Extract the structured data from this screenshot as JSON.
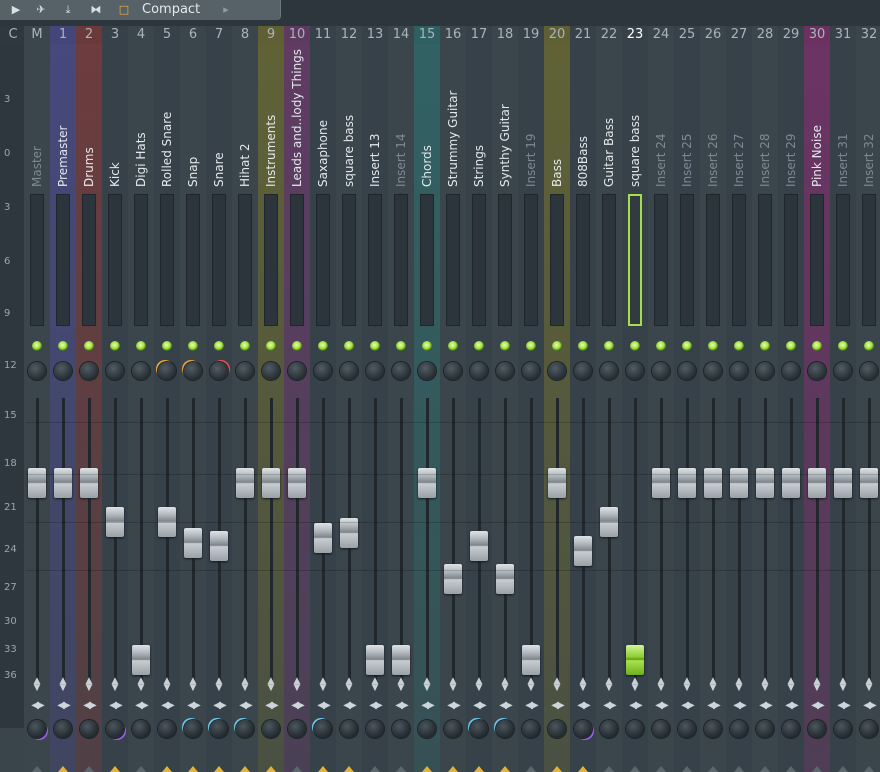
{
  "toolbar": {
    "view_label": "Compact",
    "icons": [
      "play-arrow-icon",
      "mixer-icon",
      "download-icon",
      "routing-icon",
      "view-square-icon",
      "chevron-right-icon"
    ]
  },
  "header": {
    "c_label": "C",
    "m_label": "M"
  },
  "scale": [
    "3",
    "0",
    "3",
    "6",
    "9",
    "12",
    "15",
    "18",
    "21",
    "24",
    "27",
    "30",
    "33",
    "36"
  ],
  "colors": {
    "selected_accent": "#a6dd4a",
    "led_green": "#9fe03c",
    "route_gold": "#e2b23a",
    "purple": "#9b5cf2",
    "cyan": "#6cc6e8"
  },
  "strips": [
    {
      "num": "M",
      "name": "Master",
      "dim": true,
      "fader": 0.73,
      "tint": ""
    },
    {
      "num": "1",
      "name": "Premaster",
      "dim": false,
      "fader": 0.73,
      "tint": "#4a4a8a"
    },
    {
      "num": "2",
      "name": "Drums",
      "dim": false,
      "fader": 0.73,
      "tint": "#7a3a3a"
    },
    {
      "num": "3",
      "name": "Kick",
      "dim": false,
      "fader": 0.58,
      "tint": ""
    },
    {
      "num": "4",
      "name": "Digi Hats",
      "dim": false,
      "fader": 0.05,
      "tint": ""
    },
    {
      "num": "5",
      "name": "Rolled Snare",
      "dim": false,
      "fader": 0.58,
      "tint": ""
    },
    {
      "num": "6",
      "name": "Snap",
      "dim": false,
      "fader": 0.5,
      "tint": ""
    },
    {
      "num": "7",
      "name": "Snare",
      "dim": false,
      "fader": 0.49,
      "tint": ""
    },
    {
      "num": "8",
      "name": "Hihat 2",
      "dim": false,
      "fader": 0.73,
      "tint": ""
    },
    {
      "num": "9",
      "name": "Instruments",
      "dim": false,
      "fader": 0.73,
      "tint": "#6a6a30"
    },
    {
      "num": "10",
      "name": "Leads and..lody Things",
      "dim": false,
      "fader": 0.73,
      "tint": "#6a3a6a"
    },
    {
      "num": "11",
      "name": "Saxaphone",
      "dim": false,
      "fader": 0.52,
      "tint": ""
    },
    {
      "num": "12",
      "name": "square bass",
      "dim": false,
      "fader": 0.54,
      "tint": ""
    },
    {
      "num": "13",
      "name": "Insert 13",
      "dim": false,
      "fader": 0.05,
      "tint": ""
    },
    {
      "num": "14",
      "name": "Insert 14",
      "dim": true,
      "fader": 0.05,
      "tint": ""
    },
    {
      "num": "15",
      "name": "Chords",
      "dim": false,
      "fader": 0.73,
      "tint": "#2f6a6a"
    },
    {
      "num": "16",
      "name": "Strummy Guitar",
      "dim": false,
      "fader": 0.36,
      "tint": ""
    },
    {
      "num": "17",
      "name": "Strings",
      "dim": false,
      "fader": 0.49,
      "tint": ""
    },
    {
      "num": "18",
      "name": "Synthy Guitar",
      "dim": false,
      "fader": 0.36,
      "tint": ""
    },
    {
      "num": "19",
      "name": "Insert 19",
      "dim": true,
      "fader": 0.05,
      "tint": ""
    },
    {
      "num": "20",
      "name": "Bass",
      "dim": false,
      "fader": 0.73,
      "tint": "#6a6a30"
    },
    {
      "num": "21",
      "name": "808Bass",
      "dim": false,
      "fader": 0.47,
      "tint": ""
    },
    {
      "num": "22",
      "name": "Guitar Bass",
      "dim": false,
      "fader": 0.58,
      "tint": ""
    },
    {
      "num": "23",
      "name": "square bass",
      "dim": false,
      "fader": 0.05,
      "tint": "",
      "selected": true
    },
    {
      "num": "24",
      "name": "Insert 24",
      "dim": true,
      "fader": 0.73,
      "tint": ""
    },
    {
      "num": "25",
      "name": "Insert 25",
      "dim": true,
      "fader": 0.73,
      "tint": ""
    },
    {
      "num": "26",
      "name": "Insert 26",
      "dim": true,
      "fader": 0.73,
      "tint": ""
    },
    {
      "num": "27",
      "name": "Insert 27",
      "dim": true,
      "fader": 0.73,
      "tint": ""
    },
    {
      "num": "28",
      "name": "Insert 28",
      "dim": true,
      "fader": 0.73,
      "tint": ""
    },
    {
      "num": "29",
      "name": "Insert 29",
      "dim": true,
      "fader": 0.73,
      "tint": ""
    },
    {
      "num": "30",
      "name": "Pink Noise",
      "dim": false,
      "fader": 0.73,
      "tint": "#7a2f6a"
    },
    {
      "num": "31",
      "name": "Insert 31",
      "dim": true,
      "fader": 0.73,
      "tint": ""
    },
    {
      "num": "32",
      "name": "Insert 32",
      "dim": true,
      "fader": 0.73,
      "tint": ""
    }
  ]
}
